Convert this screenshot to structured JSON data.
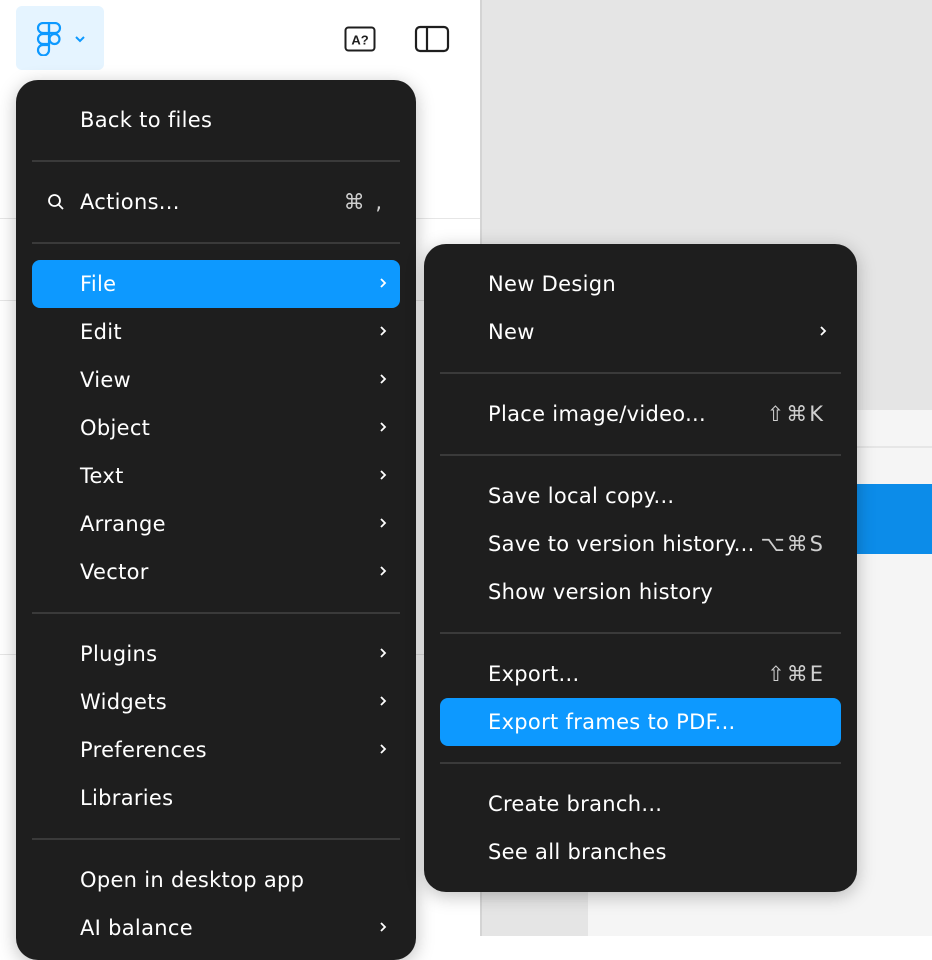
{
  "toolbar": {
    "logo_icon": "figma-logo-icon",
    "fonts_icon": "missing-fonts-icon",
    "fonts_text": "A?",
    "sidebar_icon": "sidebar-toggle-icon"
  },
  "colors": {
    "menu_bg": "#1e1e1e",
    "highlight": "#0d99ff",
    "logo_button_bg": "#e5f4ff",
    "canvas_bg": "#e5e5e5",
    "canvas_accent": "#0c8ce9"
  },
  "main_menu": {
    "back": "Back to files",
    "actions": {
      "label": "Actions...",
      "shortcut": "⌘ ,"
    },
    "items": [
      {
        "label": "File"
      },
      {
        "label": "Edit"
      },
      {
        "label": "View"
      },
      {
        "label": "Object"
      },
      {
        "label": "Text"
      },
      {
        "label": "Arrange"
      },
      {
        "label": "Vector"
      },
      {
        "label": "Plugins"
      },
      {
        "label": "Widgets"
      },
      {
        "label": "Preferences"
      },
      {
        "label": "Libraries"
      },
      {
        "label": "Open in desktop app"
      },
      {
        "label": "AI balance"
      }
    ]
  },
  "file_menu": {
    "items": [
      {
        "label": "New Design",
        "shortcut": ""
      },
      {
        "label": "New",
        "shortcut": ""
      },
      {
        "label": "Place image/video...",
        "shortcut": "⇧⌘K"
      },
      {
        "label": "Save local copy...",
        "shortcut": ""
      },
      {
        "label": "Save to version history...",
        "shortcut": "⌥⌘S"
      },
      {
        "label": "Show version history",
        "shortcut": ""
      },
      {
        "label": "Export...",
        "shortcut": "⇧⌘E"
      },
      {
        "label": "Export frames to PDF...",
        "shortcut": ""
      },
      {
        "label": "Create branch...",
        "shortcut": ""
      },
      {
        "label": "See all branches",
        "shortcut": ""
      }
    ]
  }
}
